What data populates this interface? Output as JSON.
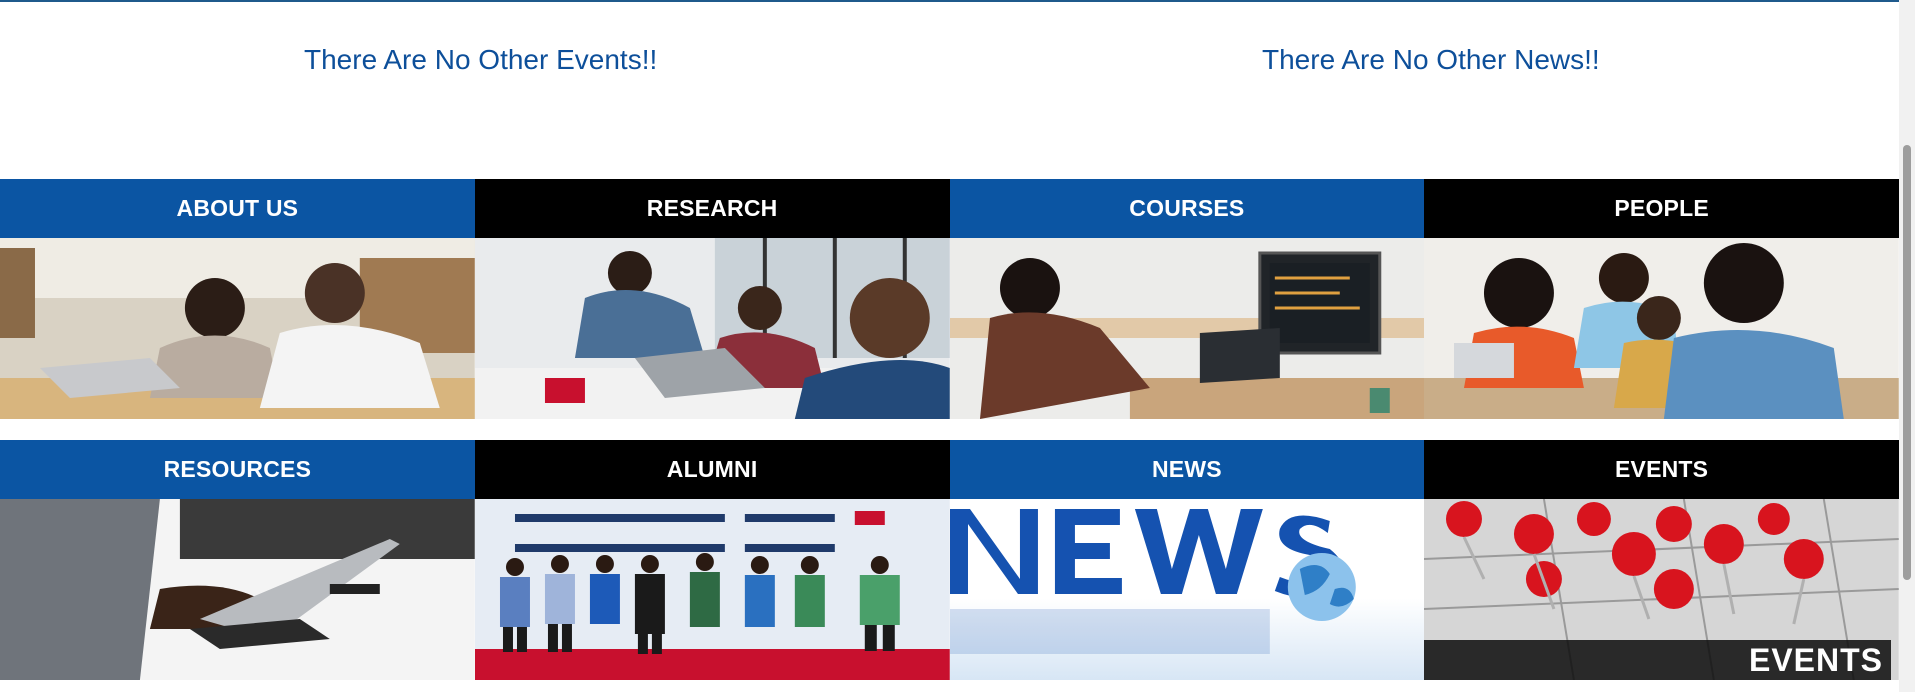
{
  "notices": {
    "events": "There Are No Other Events!!",
    "news": "There Are No Other News!!"
  },
  "cards": [
    {
      "label": "ABOUT US",
      "theme": "blue",
      "image": "students-with-laptops"
    },
    {
      "label": "RESEARCH",
      "theme": "black",
      "image": "researchers-at-laptop"
    },
    {
      "label": "COURSES",
      "theme": "blue",
      "image": "student-coding"
    },
    {
      "label": "PEOPLE",
      "theme": "black",
      "image": "group-of-students"
    },
    {
      "label": "RESOURCES",
      "theme": "blue",
      "image": "typing-on-laptop"
    },
    {
      "label": "ALUMNI",
      "theme": "black",
      "image": "alumni-group-photo"
    },
    {
      "label": "NEWS",
      "theme": "blue",
      "image": "news-globe"
    },
    {
      "label": "EVENTS",
      "theme": "black",
      "image": "calendar-pins",
      "overlay_text": "EVENTS"
    }
  ],
  "colors": {
    "blue": "#0b55a3",
    "black": "#000000",
    "notice_text": "#0d4f9a"
  }
}
